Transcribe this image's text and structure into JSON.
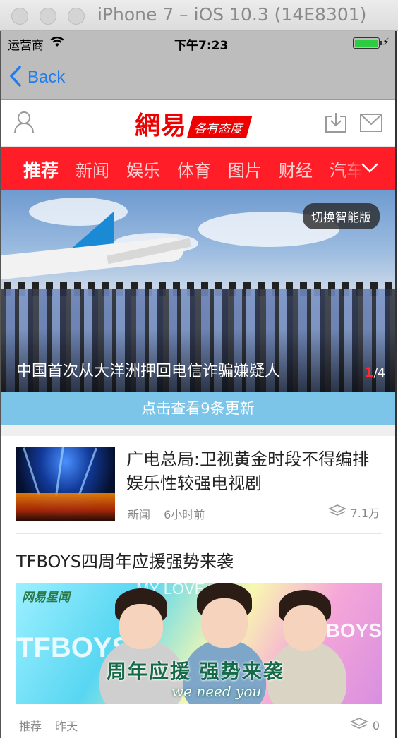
{
  "window": {
    "title": "iPhone 7 – iOS 10.3 (14E8301)"
  },
  "status_bar": {
    "carrier": "运营商",
    "time": "下午7:23",
    "battery_level": 1.0
  },
  "nav": {
    "back_label": "Back"
  },
  "header": {
    "logo_text": "網易",
    "logo_slogan": "各有态度"
  },
  "tabs": [
    {
      "label": "推荐",
      "active": true
    },
    {
      "label": "新闻",
      "active": false
    },
    {
      "label": "娱乐",
      "active": false
    },
    {
      "label": "体育",
      "active": false
    },
    {
      "label": "图片",
      "active": false
    },
    {
      "label": "财经",
      "active": false
    },
    {
      "label": "汽车",
      "active": false
    }
  ],
  "hero": {
    "switch_label": "切换智能版",
    "caption": "中国首次从大洋洲押回电信诈骗嫌疑人",
    "page_current": "1",
    "page_total": "/4"
  },
  "update_bar": {
    "label": "点击查看9条更新"
  },
  "articles": [
    {
      "title": "广电总局:卫视黄金时段不得编排娱乐性较强电视剧",
      "source": "新闻",
      "time": "6小时前",
      "replies": "7.1万"
    },
    {
      "title": "TFBOYS四周年应援强势来袭",
      "banner_watermark": "网易星闻",
      "banner_bg_text": "TFBOYS",
      "banner_bg_text_right": "TFBOYS",
      "banner_top_text": "MY LOVE",
      "banner_headline": "周年应援 强势来袭",
      "banner_subline": "we need you",
      "source": "推荐",
      "time": "昨天",
      "replies": "0"
    }
  ],
  "colors": {
    "accent": "#ff1e27",
    "link": "#1e7cf0",
    "update_bar": "#7dc5e8"
  }
}
